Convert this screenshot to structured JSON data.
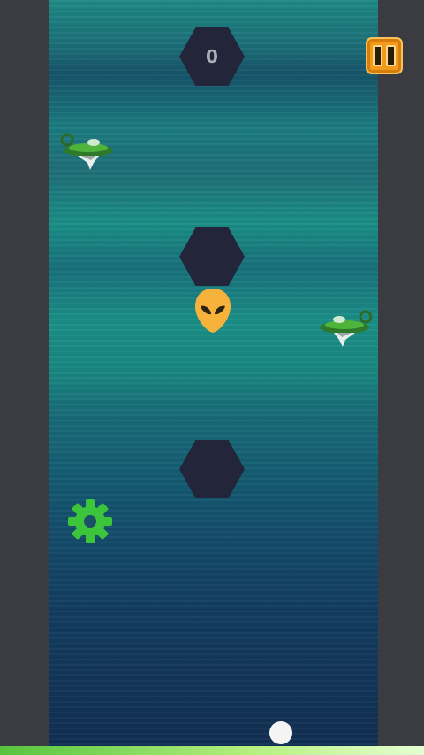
{
  "game": {
    "score": "0",
    "colors": {
      "obstacle": "#23253a",
      "pause_button": "#f29a1c",
      "alien_player": "#f7b23b",
      "settings_gear": "#3cc43a",
      "ground": "#56c43e",
      "ball": "#f4f4f4"
    },
    "icons": [
      "pause-icon",
      "alien-head-icon",
      "gear-icon",
      "ufo-ship-icon"
    ]
  }
}
